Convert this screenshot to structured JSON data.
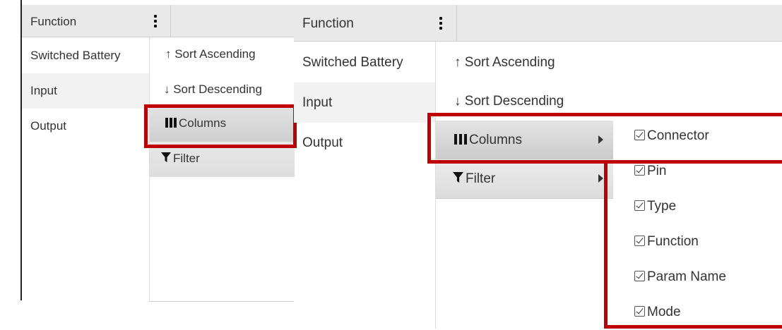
{
  "left_panel": {
    "header": {
      "title": "Function"
    },
    "rows": [
      "Switched Battery",
      "Input",
      "Output"
    ],
    "menu": {
      "sort_asc": "↑ Sort Ascending",
      "sort_desc": "↓ Sort Descending",
      "columns": "Columns",
      "filter": "Filter"
    }
  },
  "right_panel": {
    "header": {
      "title": "Function"
    },
    "rows": [
      "Switched Battery",
      "Input",
      "Output"
    ],
    "menu": {
      "sort_asc": "↑ Sort Ascending",
      "sort_desc": "↓ Sort Descending",
      "columns": "Columns",
      "filter": "Filter"
    },
    "columns_submenu": [
      "Connector",
      "Pin",
      "Type",
      "Function",
      "Param Name",
      "Mode"
    ]
  },
  "colors": {
    "highlight": "#c00000",
    "header_bg": "#e9e9e9",
    "row_alt_bg": "#f2f2f2"
  }
}
